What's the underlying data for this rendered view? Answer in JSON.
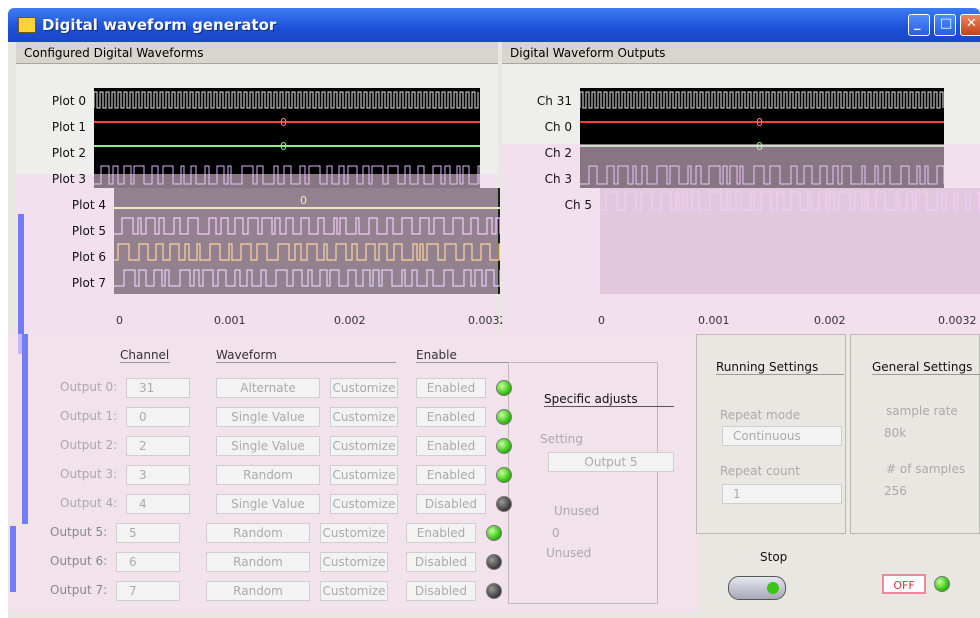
{
  "window": {
    "title": "Digital waveform generator"
  },
  "left_graph": {
    "title": "Configured Digital Waveforms",
    "plots": [
      "Plot 0",
      "Plot 1",
      "Plot 2",
      "Plot 3",
      "Plot 4",
      "Plot 5",
      "Plot 6",
      "Plot 7"
    ],
    "ticks": [
      "0",
      "0.001",
      "0.002",
      "0.0032"
    ],
    "zero_label": "0"
  },
  "right_graph": {
    "title": "Digital Waveform Outputs",
    "channels": [
      "Ch 31",
      "Ch 0",
      "Ch 2",
      "Ch 3",
      "Ch 5"
    ],
    "ticks": [
      "0",
      "0.001",
      "0.002",
      "0.0032"
    ],
    "zero_label": "0"
  },
  "table": {
    "headers": {
      "channel": "Channel",
      "waveform": "Waveform",
      "enable": "Enable"
    },
    "customize_label": "Customize",
    "rows": [
      {
        "label": "Output 0:",
        "channel": "31",
        "waveform": "Alternate",
        "enable": "Enabled",
        "on": true
      },
      {
        "label": "Output 1:",
        "channel": "0",
        "waveform": "Single Value",
        "enable": "Enabled",
        "on": true
      },
      {
        "label": "Output 2:",
        "channel": "2",
        "waveform": "Single Value",
        "enable": "Enabled",
        "on": true
      },
      {
        "label": "Output 3:",
        "channel": "3",
        "waveform": "Random",
        "enable": "Enabled",
        "on": true
      },
      {
        "label": "Output 4:",
        "channel": "4",
        "waveform": "Single Value",
        "enable": "Disabled",
        "on": false
      },
      {
        "label": "Output 5:",
        "channel": "5",
        "waveform": "Random",
        "enable": "Enabled",
        "on": true
      },
      {
        "label": "Output 6:",
        "channel": "6",
        "waveform": "Random",
        "enable": "Disabled",
        "on": false
      },
      {
        "label": "Output 7:",
        "channel": "7",
        "waveform": "Random",
        "enable": "Disabled",
        "on": false
      }
    ]
  },
  "specific": {
    "title": "Specific adjusts",
    "setting_label": "Setting",
    "setting_value": "Output 5",
    "unused1": "Unused",
    "unused_value": "0",
    "unused2": "Unused"
  },
  "running": {
    "title": "Running Settings",
    "repeat_mode_label": "Repeat mode",
    "repeat_mode_value": "Continuous",
    "repeat_count_label": "Repeat count",
    "repeat_count_value": "1"
  },
  "general": {
    "title": "General Settings",
    "sample_rate_label": "sample rate",
    "sample_rate_value": "80k",
    "samples_label": "# of samples",
    "samples_value": "256"
  },
  "stop": {
    "label": "Stop",
    "toggle_label": "OFF"
  }
}
